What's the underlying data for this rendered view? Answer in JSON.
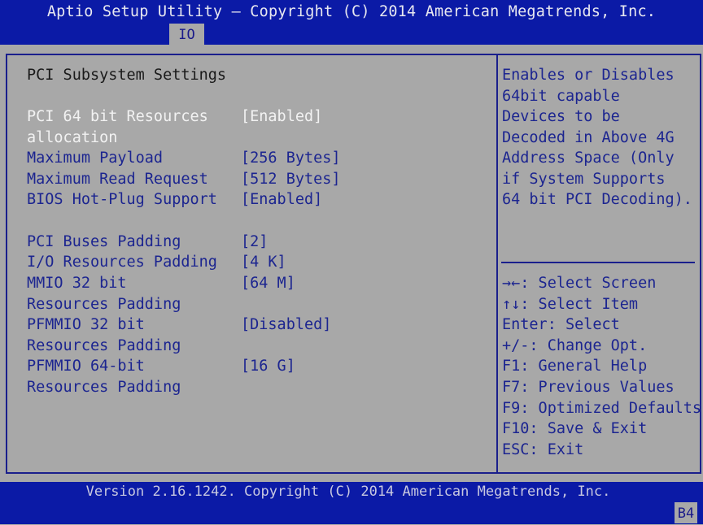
{
  "header": {
    "title": "Aptio Setup Utility – Copyright (C) 2014 American Megatrends, Inc.",
    "active_tab": "IO"
  },
  "main": {
    "section_title": "PCI Subsystem Settings",
    "settings": [
      {
        "label_lines": [
          "PCI 64 bit Resources",
          "allocation"
        ],
        "value": "[Enabled]",
        "selected": true
      },
      {
        "label_lines": [
          "Maximum Payload"
        ],
        "value": "[256 Bytes]",
        "selected": false
      },
      {
        "label_lines": [
          "Maximum Read Request"
        ],
        "value": "[512 Bytes]",
        "selected": false
      },
      {
        "label_lines": [
          "BIOS Hot-Plug Support"
        ],
        "value": "[Enabled]",
        "selected": false
      },
      {
        "label_lines": [
          "PCI Buses Padding"
        ],
        "value": "[2]",
        "selected": false
      },
      {
        "label_lines": [
          "I/O Resources Padding"
        ],
        "value": "[4 K]",
        "selected": false
      },
      {
        "label_lines": [
          "MMIO 32 bit",
          "Resources Padding"
        ],
        "value": "[64 M]",
        "selected": false
      },
      {
        "label_lines": [
          "PFMMIO 32 bit",
          "Resources Padding"
        ],
        "value": "[Disabled]",
        "selected": false
      },
      {
        "label_lines": [
          "PFMMIO 64-bit",
          "Resources Padding"
        ],
        "value": "[16 G]",
        "selected": false
      }
    ]
  },
  "help": {
    "description_lines": [
      "Enables or Disables",
      "64bit capable",
      "Devices to be",
      "Decoded in Above 4G",
      "Address Space (Only",
      "if System Supports",
      "64 bit PCI Decoding)."
    ],
    "keys": [
      "→←: Select Screen",
      "↑↓: Select Item",
      "Enter: Select",
      "+/-: Change Opt.",
      "F1: General Help",
      "F7: Previous Values",
      "F9: Optimized Defaults",
      "F10: Save & Exit",
      "ESC: Exit"
    ]
  },
  "footer": {
    "version": "Version 2.16.1242. Copyright (C) 2014 American Megatrends, Inc.",
    "post_code": "B4"
  }
}
